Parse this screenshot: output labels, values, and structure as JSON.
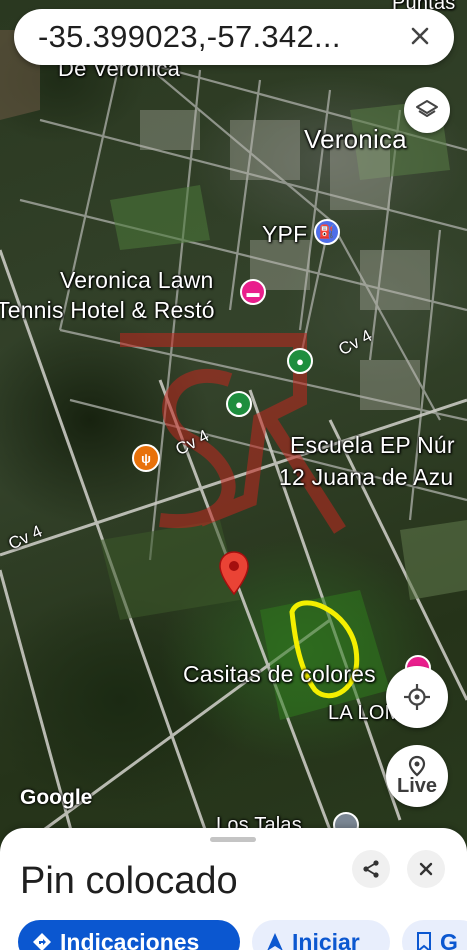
{
  "search": {
    "value": "-35.399023,-57.342..."
  },
  "map_labels": {
    "town_top": "De Veronica",
    "town": "Veronica",
    "fuel": "YPF",
    "hotel_line1": "Veronica Lawn",
    "hotel_line2": "Tennis Hotel & Restó",
    "school_line1": "Escuela EP Núr",
    "school_line2": "12 Juana de Azu",
    "houses": "Casitas de colores",
    "area": "LA LOMA",
    "bottom": "Los Talas",
    "corner": "Puntas",
    "road_cv4_a": "Cv 4",
    "road_cv4_b": "Cv 4",
    "road_cv4_c": "Cv 4",
    "google": "Google"
  },
  "controls": {
    "live_label": "Live"
  },
  "sheet": {
    "title": "Pin colocado",
    "chips": {
      "directions": "Indicaciones",
      "start": "Iniciar",
      "save_partial": "G"
    }
  },
  "colors": {
    "primary_blue": "#0b57d0",
    "pin_red": "#ea4335",
    "poi_pink": "#e91e8c",
    "poi_green": "#1e8e3e",
    "poi_orange": "#e8710a",
    "annotation_yellow": "#f4ef00",
    "watermark_red": "#c0271f"
  },
  "icons": [
    "close-icon",
    "layers-icon",
    "my-location-icon",
    "live-view-icon",
    "share-icon",
    "directions-icon",
    "navigation-icon",
    "bookmark-icon",
    "map-pin-icon"
  ]
}
